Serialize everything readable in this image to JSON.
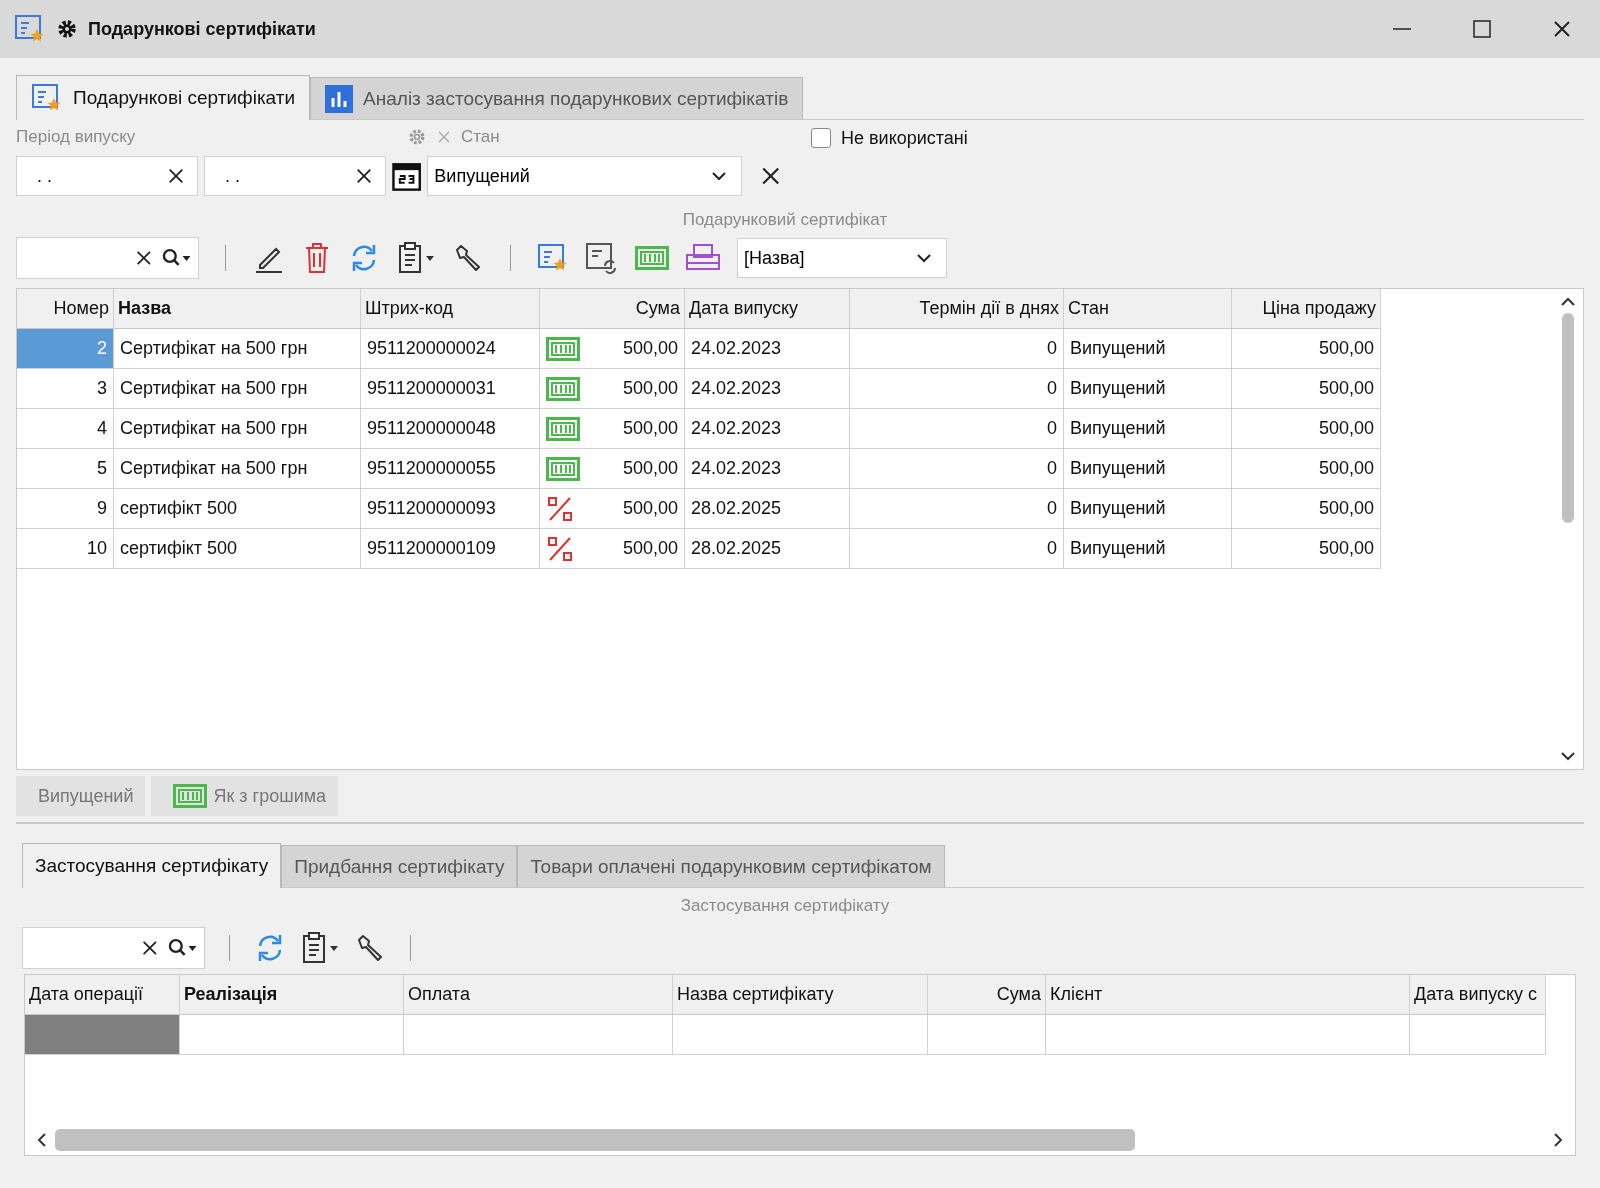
{
  "window": {
    "title": "Подарункові сертифікати"
  },
  "tabs": [
    {
      "label": "Подарункові сертифікати",
      "kind": "certificate",
      "selected": true
    },
    {
      "label": "Аналіз застосування подарункових сертифікатів",
      "kind": "chart",
      "selected": false
    }
  ],
  "filters": {
    "period_label": "Період випуску",
    "date_from": ". .",
    "date_to": ". .",
    "status_label": "Стан",
    "status_value": "Випущений",
    "unused": {
      "label": "Не використані",
      "checked": false
    }
  },
  "section_label": "Подарунковий сертифікат",
  "sort_field": "[Назва]",
  "table": {
    "columns": [
      {
        "label": "Номер",
        "sorted": false
      },
      {
        "label": "Назва",
        "sorted": true
      },
      {
        "label": "Штрих-код",
        "sorted": false
      },
      {
        "label": "Сума",
        "sorted": false
      },
      {
        "label": "Дата випуску",
        "sorted": false
      },
      {
        "label": "Термін дії в днях",
        "sorted": false
      },
      {
        "label": "Стан",
        "sorted": false
      },
      {
        "label": "Ціна продажу",
        "sorted": false
      }
    ],
    "rows": [
      {
        "number": "2",
        "name": "Сертифікат на 500 грн",
        "barcode": "9511200000024",
        "kind": "cash",
        "sum": "500,00",
        "date": "24.02.2023",
        "days": "0",
        "status": "Випущений",
        "price": "500,00",
        "selected": true
      },
      {
        "number": "3",
        "name": "Сертифікат на 500 грн",
        "barcode": "9511200000031",
        "kind": "cash",
        "sum": "500,00",
        "date": "24.02.2023",
        "days": "0",
        "status": "Випущений",
        "price": "500,00",
        "selected": false
      },
      {
        "number": "4",
        "name": "Сертифікат на 500 грн",
        "barcode": "9511200000048",
        "kind": "cash",
        "sum": "500,00",
        "date": "24.02.2023",
        "days": "0",
        "status": "Випущений",
        "price": "500,00",
        "selected": false
      },
      {
        "number": "5",
        "name": "Сертифікат на 500 грн",
        "barcode": "9511200000055",
        "kind": "cash",
        "sum": "500,00",
        "date": "24.02.2023",
        "days": "0",
        "status": "Випущений",
        "price": "500,00",
        "selected": false
      },
      {
        "number": "9",
        "name": "сертифікт 500",
        "barcode": "9511200000093",
        "kind": "percent",
        "sum": "500,00",
        "date": "28.02.2025",
        "days": "0",
        "status": "Випущений",
        "price": "500,00",
        "selected": false
      },
      {
        "number": "10",
        "name": "сертифікт 500",
        "barcode": "9511200000109",
        "kind": "percent",
        "sum": "500,00",
        "date": "28.02.2025",
        "days": "0",
        "status": "Випущений",
        "price": "500,00",
        "selected": false
      }
    ]
  },
  "legend": [
    {
      "label": "Випущений",
      "kind": "plain"
    },
    {
      "label": "Як з грошима",
      "kind": "cash"
    }
  ],
  "detail_tabs": [
    {
      "label": "Застосування сертифікату",
      "selected": true
    },
    {
      "label": "Придбання сертифікату",
      "selected": false
    },
    {
      "label": "Товари оплачені подарунковим сертифікатом",
      "selected": false
    }
  ],
  "detail_label": "Застосування сертифікату",
  "detail_table": {
    "columns": [
      {
        "label": "Дата операції",
        "sorted": false
      },
      {
        "label": "Реалізація",
        "sorted": true
      },
      {
        "label": "Оплата",
        "sorted": false
      },
      {
        "label": "Назва сертифікату",
        "sorted": false
      },
      {
        "label": "Сума",
        "sorted": false
      },
      {
        "label": "Клієнт",
        "sorted": false
      },
      {
        "label": "Дата випуску с",
        "sorted": false
      }
    ]
  }
}
